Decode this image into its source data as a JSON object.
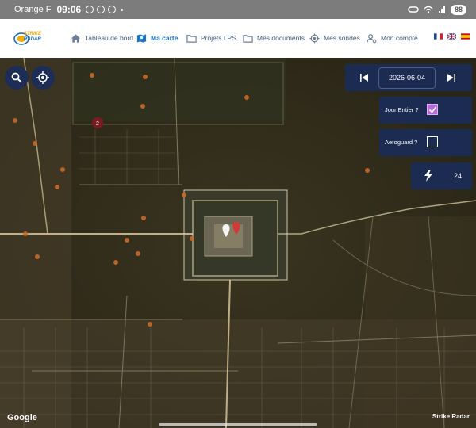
{
  "status_bar": {
    "carrier": "Orange F",
    "time": "09:06",
    "battery": "88"
  },
  "brand": {
    "logo_text_top": "STRIKE",
    "logo_text_bottom": "RADAR"
  },
  "nav": {
    "items": [
      {
        "label": "Tableau de bord"
      },
      {
        "label": "Ma carte"
      },
      {
        "label": "Projets LPS"
      },
      {
        "label": "Mes documents"
      },
      {
        "label": "Mes sondes"
      },
      {
        "label": "Mon compte"
      }
    ]
  },
  "languages": [
    "fr",
    "en",
    "es"
  ],
  "controls": {
    "date": "2026-06-04",
    "full_day_label": "Jour Entier ?",
    "full_day_checked": true,
    "aeroguard_label": "Aeroguard ?",
    "aeroguard_checked": false,
    "strike_count": "24"
  },
  "map": {
    "cluster_badge": "2",
    "google_label": "Google",
    "attribution": "Strike Radar"
  },
  "colors": {
    "panel": "#1c2b52",
    "accent": "#1a73c9",
    "strike": "#c8692a",
    "checkbox_checked": "#b86bd6"
  }
}
